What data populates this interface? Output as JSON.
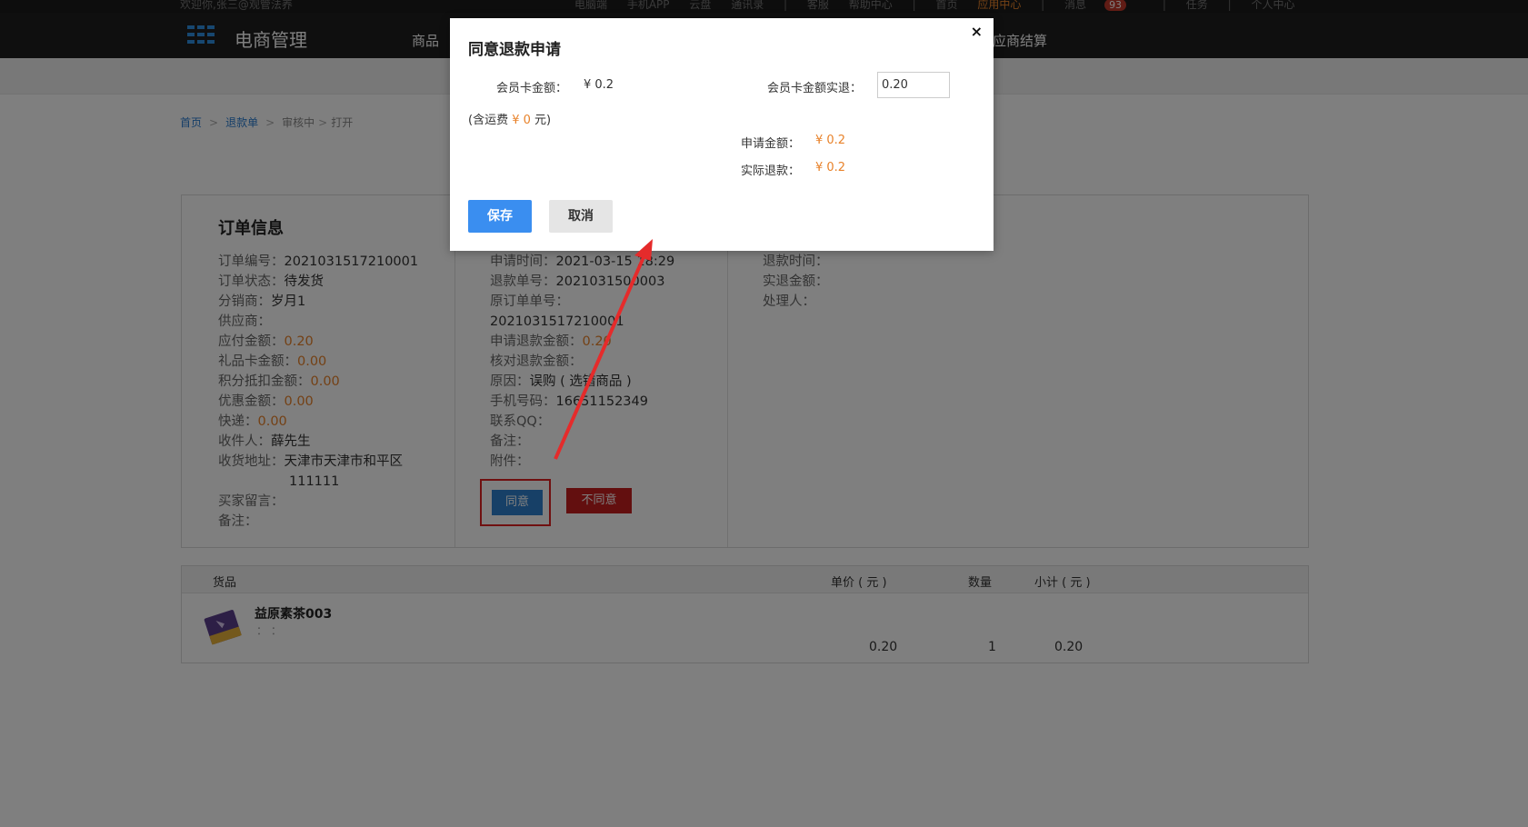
{
  "topbar": {
    "welcome": "欢迎你,张三@观管法养",
    "links": [
      "电脑端",
      "手机APP",
      "云盘",
      "通讯录",
      "客服",
      "帮助中心",
      "首页",
      "应用中心",
      "消息",
      "任务",
      "个人中心"
    ],
    "msg_badge": "93"
  },
  "navbar": {
    "logo_text": "电商管理",
    "item_goods": "商品",
    "item_settle": "应商结算"
  },
  "breadcrumb": {
    "home": "首页",
    "refund": "退款单",
    "reviewing": "审核中",
    "open": "打开"
  },
  "order": {
    "title": "订单信息",
    "number_label": "订单编号：",
    "number": "2021031517210001",
    "status_label": "订单状态：",
    "status": "待发货",
    "distributor_label": "分销商：",
    "distributor": "岁月1",
    "supplier_label": "供应商：",
    "payable_label": "应付金额：",
    "payable": "0.20",
    "giftcard_label": "礼品卡金额：",
    "giftcard": "0.00",
    "points_label": "积分抵扣金额：",
    "points": "0.00",
    "discount_label": "优惠金额：",
    "discount": "0.00",
    "express_label": "快递：",
    "express": "0.00",
    "receiver_label": "收件人：",
    "receiver": "薛先生",
    "address_label": "收货地址：",
    "address": "天津市天津市和平区",
    "address2": "111111",
    "buyer_msg_label": "买家留言：",
    "remark_label": "备注："
  },
  "refund": {
    "apply_time_label": "申请时间：",
    "apply_time": "2021-03-15 18:29",
    "refund_no_label": "退款单号：",
    "refund_no": "2021031500003",
    "orig_order_label": "原订单单号：",
    "orig_order": "2021031517210001",
    "apply_amount_label": "申请退款金额：",
    "apply_amount": "0.20",
    "check_amount_label": "核对退款金额：",
    "reason_label": "原因：",
    "reason": "误购 ( 选错商品 )",
    "phone_label": "手机号码：",
    "phone": "16651152349",
    "qq_label": "联系QQ：",
    "remark_label": "备注：",
    "attach_label": "附件：",
    "agree_label": "同意",
    "disagree_label": "不同意"
  },
  "refund_result": {
    "refund_time_label": "退款时间：",
    "actual_amount_label": "实退金额：",
    "handler_label": "处理人："
  },
  "goods": {
    "col_goods": "货品",
    "col_price": "单价 ( 元 )",
    "col_qty": "数量",
    "col_subtotal": "小计 ( 元 )",
    "name": "益原素茶003",
    "spec": "：  ：",
    "price": "0.20",
    "qty": "1",
    "subtotal": "0.20"
  },
  "modal": {
    "title": "同意退款申请",
    "close": "×",
    "card_amount_label": "会员卡金额：",
    "card_amount": "¥ 0.2",
    "card_refund_label": "会员卡金额实退：",
    "card_refund_value": "0.20",
    "shipping_prefix": "(含运费",
    "shipping_value": "¥ 0",
    "shipping_suffix": "元)",
    "apply_amount_label": "申请金额：",
    "apply_amount": "¥ 0.2",
    "actual_refund_label": "实际退款：",
    "actual_refund": "¥ 0.2",
    "save_label": "保存",
    "cancel_label": "取消"
  },
  "colors": {
    "accent_blue": "#3a8ef0",
    "orange": "#e8822a",
    "danger_red": "#c61f1f",
    "annotation_red": "#e02020"
  }
}
